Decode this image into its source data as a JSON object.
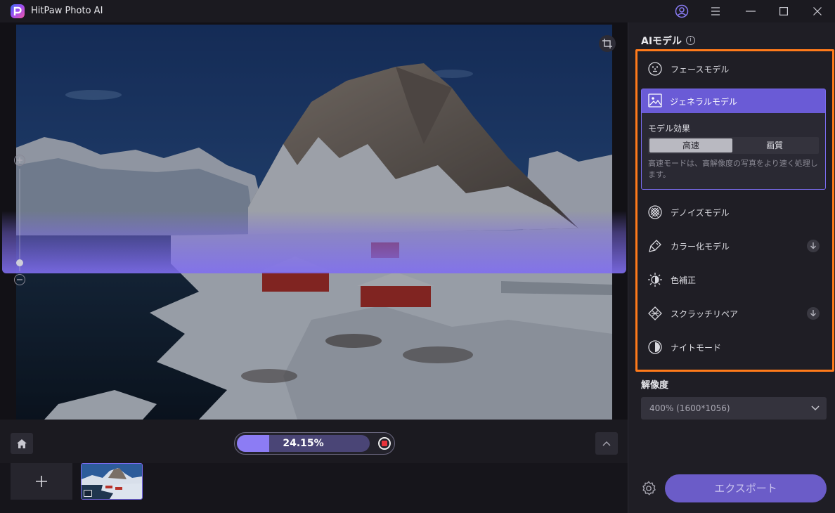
{
  "app": {
    "title": "HitPaw Photo AI"
  },
  "titlebar": {
    "account_icon": "user-circle-icon",
    "menu_icon": "hamburger-menu-icon",
    "minimize_icon": "minimize-icon",
    "maximize_icon": "maximize-icon",
    "close_icon": "close-icon"
  },
  "canvas": {
    "crop_icon": "crop-icon",
    "zoom_in_icon": "plus-circle-icon",
    "zoom_out_icon": "minus-circle-icon"
  },
  "progress": {
    "percent": 24.15,
    "label": "24.15%",
    "stop_icon": "stop-icon"
  },
  "bottombar": {
    "home_icon": "home-icon",
    "collapse_icon": "chevron-up-icon"
  },
  "thumbstrip": {
    "add_icon": "plus-icon",
    "thumb_badge_icon": "image-icon"
  },
  "panel": {
    "ai_models_title": "AIモデル",
    "info_icon_glyph": "i",
    "models": [
      {
        "label": "フェースモデル",
        "icon": "face-icon"
      },
      {
        "label": "ジェネラルモデル",
        "icon": "image-frame-icon",
        "selected": true
      },
      {
        "label": "デノイズモデル",
        "icon": "denoise-icon"
      },
      {
        "label": "カラー化モデル",
        "icon": "paint-brush-icon",
        "download": true
      },
      {
        "label": "色補正",
        "icon": "sun-icon"
      },
      {
        "label": "スクラッチリペア",
        "icon": "scratch-repair-icon",
        "download": true
      },
      {
        "label": "ナイトモード",
        "icon": "half-moon-icon"
      }
    ],
    "model_effect_label": "モデル効果",
    "effect_options": [
      "高速",
      "画質"
    ],
    "effect_selected": "高速",
    "effect_description": "高速モードは、高解像度の写真をより速く処理します。",
    "resolution_title": "解像度",
    "resolution_value": "400% (1600*1056)",
    "export_label": "エクスポート",
    "settings_icon": "gear-icon"
  },
  "colors": {
    "accent": "#6a5bd6",
    "highlight_border": "#ff7a1a",
    "progress_fill": "#8c7cf4",
    "stop_red": "#e8323a"
  }
}
